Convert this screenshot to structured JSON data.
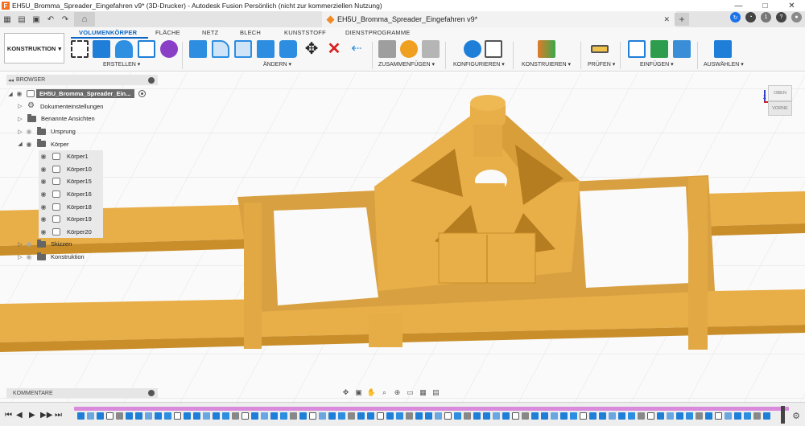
{
  "window": {
    "title": "EH5U_Bromma_Spreader_Eingefahren v9* (3D-Drucker) - Autodesk Fusion Persönlich (nicht zur kommerziellen Nutzung)",
    "app_logo": "F",
    "controls": [
      "—",
      "□",
      "✕"
    ]
  },
  "tabbar": {
    "doc_tab_title": "EH5U_Bromma_Spreader_Eingefahren v9*",
    "close_label": "✕",
    "new_tab_label": "+",
    "notification_count": "1"
  },
  "ribbon": {
    "workspace_label": "KONSTRUKTION",
    "tabs": [
      "VOLUMENKÖRPER",
      "FLÄCHE",
      "NETZ",
      "BLECH",
      "KUNSTSTOFF",
      "DIENSTPROGRAMME"
    ],
    "active_tab": "VOLUMENKÖRPER",
    "groups": [
      "ERSTELLEN ▾",
      "ÄNDERN ▾",
      "ZUSAMMENFÜGEN ▾",
      "KONFIGURIEREN ▾",
      "KONSTRUIEREN ▾",
      "PRÜFEN ▾",
      "EINFÜGEN ▾",
      "AUSWÄHLEN ▾"
    ]
  },
  "browser": {
    "header": "BROWSER",
    "root_name": "EH5U_Bromma_Spreader_Ein...",
    "items": [
      {
        "label": "Dokumenteinstellungen"
      },
      {
        "label": "Benannte Ansichten"
      },
      {
        "label": "Ursprung"
      },
      {
        "label": "Körper"
      }
    ],
    "bodies": [
      "Körper1",
      "Körper10",
      "Körper15",
      "Körper16",
      "Körper18",
      "Körper19",
      "Körper20"
    ],
    "trailing_items": [
      {
        "label": "Skizzen"
      },
      {
        "label": "Konstruktion"
      }
    ]
  },
  "viewcube": {
    "top_label": "OBEN",
    "front_label": "VORNE",
    "axis_label": "Z"
  },
  "comments": {
    "header": "KOMMENTARE"
  },
  "colors": {
    "model": "#E8AE48",
    "model_dark": "#C98E2A",
    "accent": "#0A65C4",
    "timeline_track": "#D98ADB"
  },
  "timeline": {
    "play_controls": [
      "⏮",
      "◀",
      "▶",
      "▶▶",
      "⏭"
    ]
  }
}
